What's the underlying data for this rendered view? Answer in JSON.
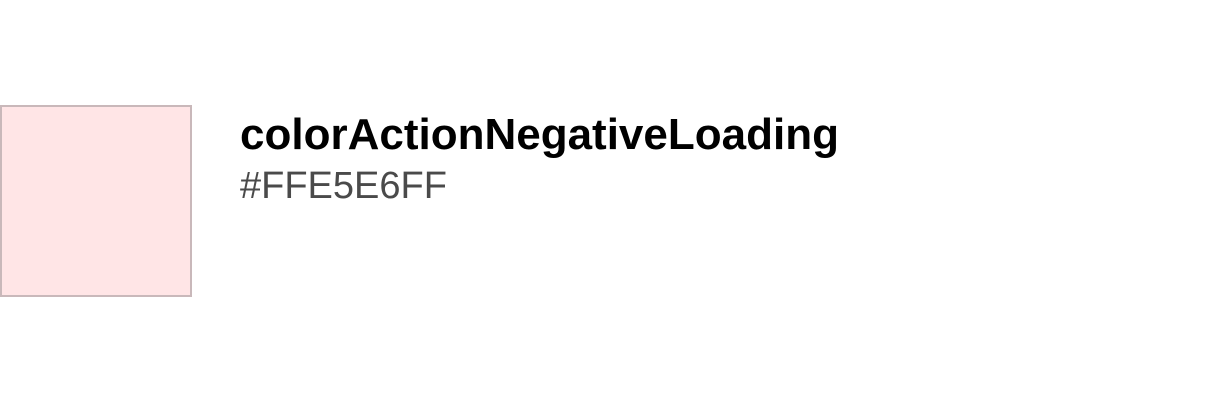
{
  "token": {
    "name": "colorActionNegativeLoading",
    "value": "#FFE5E6FF",
    "swatch_color": "#FFE5E6",
    "swatch_border_color": "#C9B8BA"
  }
}
